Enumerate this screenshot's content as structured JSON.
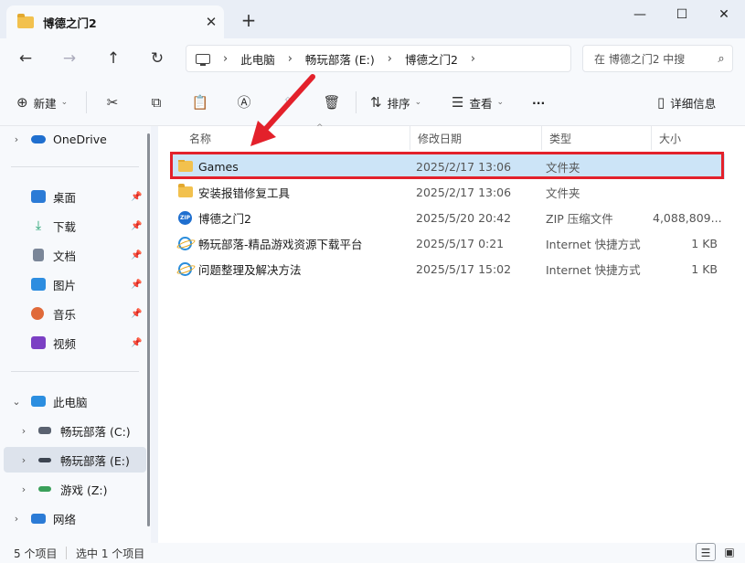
{
  "window": {
    "tab_title": "博德之门2",
    "tab_close": "✕",
    "new_tab": "+",
    "minimize": "—",
    "maximize": "☐",
    "close": "✕"
  },
  "nav": {
    "back": "←",
    "forward": "→",
    "up": "↑",
    "refresh": "↻",
    "breadcrumbs": [
      "此电脑",
      "畅玩部落 (E:)",
      "博德之门2"
    ],
    "breadcrumb_sep": "›",
    "search_placeholder": "在 博德之门2 中搜",
    "search_icon": "⌕"
  },
  "toolbar": {
    "new_label": "新建",
    "sort_label": "排序",
    "view_label": "查看",
    "more": "···",
    "details_label": "详细信息",
    "icons": [
      "cut-icon",
      "copy-icon",
      "paste-icon",
      "rename-icon",
      "share-icon",
      "delete-icon"
    ]
  },
  "sidebar": {
    "onedrive": "OneDrive",
    "quick": [
      {
        "label": "桌面",
        "icon": "desktop-icon",
        "color": "#2b7bd6"
      },
      {
        "label": "下载",
        "icon": "download-icon",
        "color": "#1a9e6b"
      },
      {
        "label": "文档",
        "icon": "document-icon",
        "color": "#7a8698"
      },
      {
        "label": "图片",
        "icon": "pictures-icon",
        "color": "#2d8de0"
      },
      {
        "label": "音乐",
        "icon": "music-icon",
        "color": "#e06a3a"
      },
      {
        "label": "视频",
        "icon": "video-icon",
        "color": "#7b3fc4"
      }
    ],
    "this_pc": "此电脑",
    "drives": [
      {
        "label": "畅玩部落 (C:)",
        "selected": false
      },
      {
        "label": "畅玩部落 (E:)",
        "selected": true
      },
      {
        "label": "游戏 (Z:)",
        "selected": false
      }
    ],
    "network": "网络"
  },
  "columns": {
    "name": "名称",
    "modified": "修改日期",
    "type": "类型",
    "size": "大小"
  },
  "files": [
    {
      "name": "Games",
      "modified": "2025/2/17 13:06",
      "type": "文件夹",
      "size": "",
      "icon": "folder-icon",
      "selected": true
    },
    {
      "name": "安装报错修复工具",
      "modified": "2025/2/17 13:06",
      "type": "文件夹",
      "size": "",
      "icon": "folder-icon",
      "selected": false
    },
    {
      "name": "博德之门2",
      "modified": "2025/5/20 20:42",
      "type": "ZIP 压缩文件",
      "size": "4,088,809...",
      "icon": "zip-icon",
      "selected": false
    },
    {
      "name": "畅玩部落-精品游戏资源下载平台",
      "modified": "2025/5/17 0:21",
      "type": "Internet 快捷方式",
      "size": "1 KB",
      "icon": "internet-shortcut-icon",
      "selected": false
    },
    {
      "name": "问题整理及解决方法",
      "modified": "2025/5/17 15:02",
      "type": "Internet 快捷方式",
      "size": "1 KB",
      "icon": "internet-shortcut-icon",
      "selected": false
    }
  ],
  "status": {
    "count": "5 个项目",
    "selected": "选中 1 个项目"
  },
  "colors": {
    "highlight_box": "#e3212b",
    "selection": "#cce4f7"
  }
}
